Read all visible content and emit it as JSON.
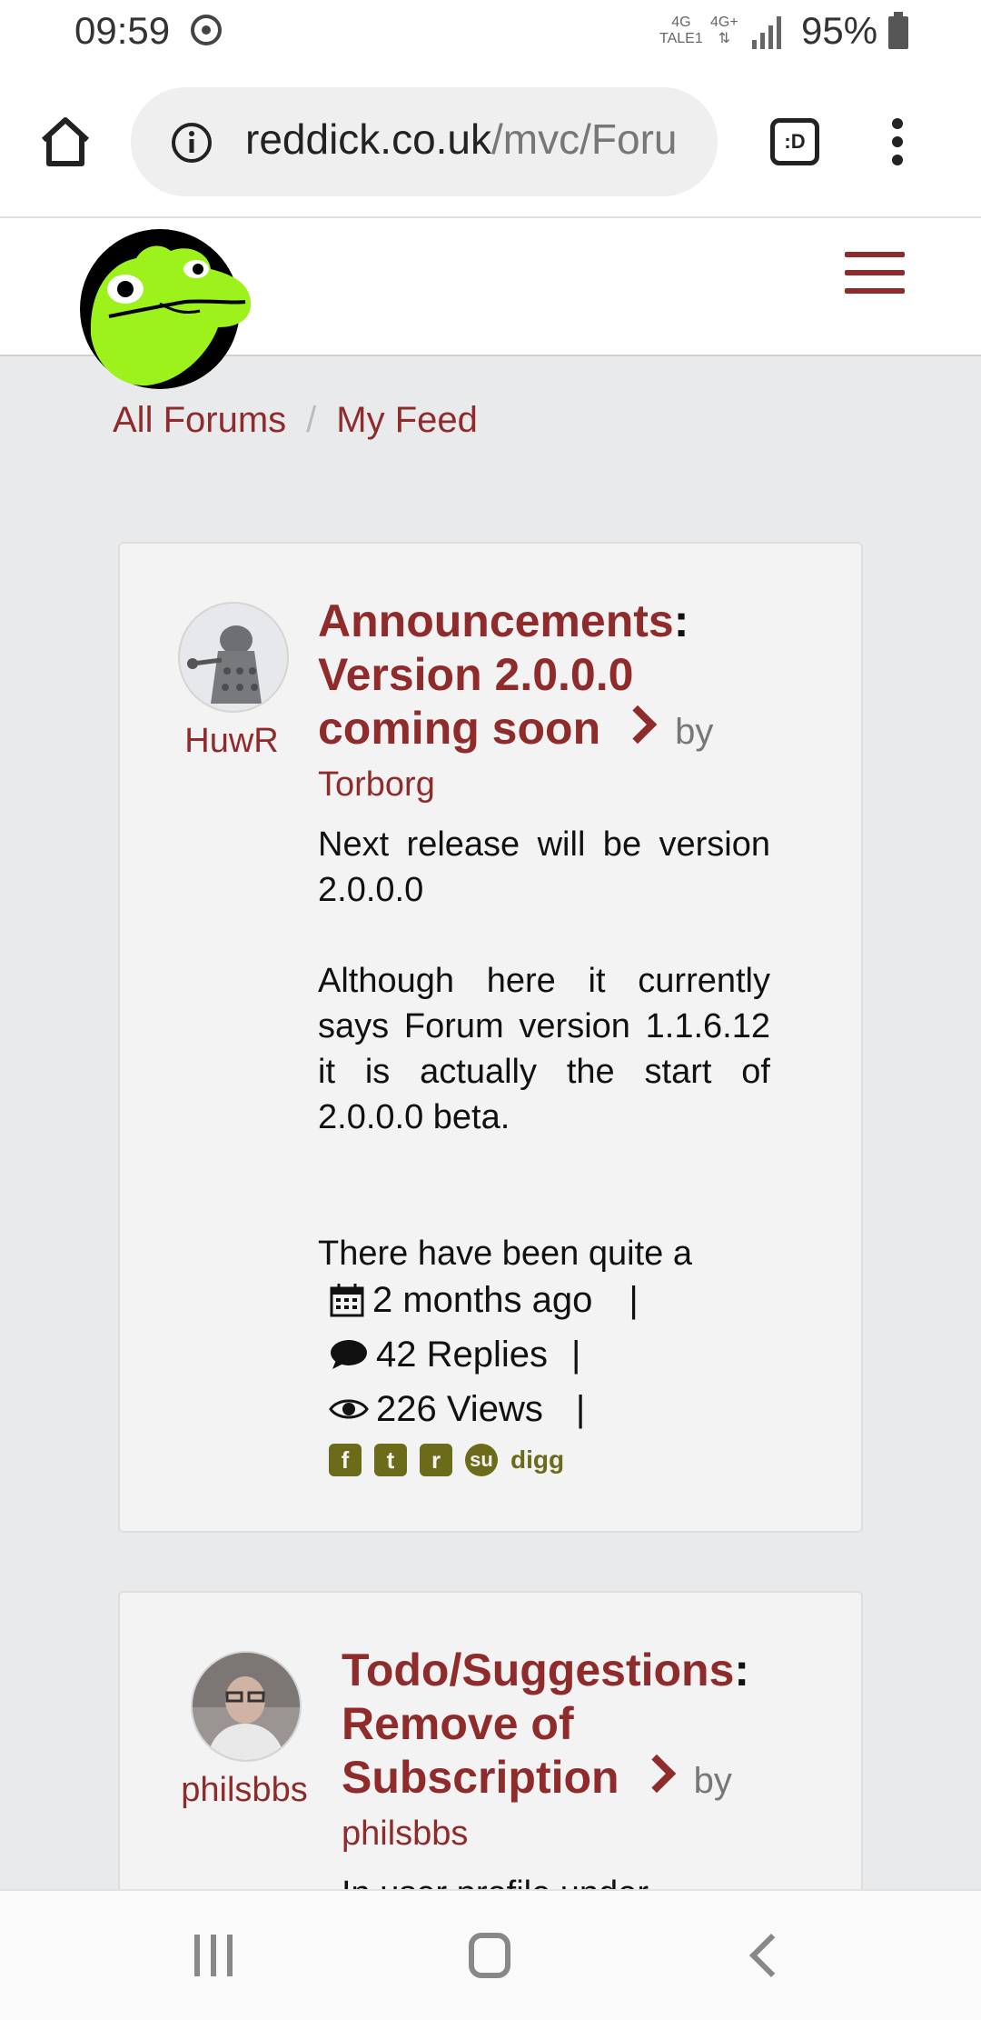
{
  "status_bar": {
    "time": "09:59",
    "net1_top": "4G",
    "net1_bottom": "TALE1",
    "net2_top": "4G+",
    "battery": "95%"
  },
  "browser": {
    "url_host": "reddick.co.uk",
    "url_path": "/mvc/Foru",
    "tab_label": ":D"
  },
  "breadcrumb": {
    "items": [
      "All Forums",
      "My Feed"
    ],
    "separator": "/"
  },
  "posts": [
    {
      "author": "HuwR",
      "forum": "Announcements",
      "colon": ":",
      "title_lines": [
        "Version 2.0.0.0",
        "coming soon"
      ],
      "by_label": "by",
      "byline_author": "Torborg",
      "body": [
        "Next release will be version 2.0.0.0",
        "Although here it currently says Forum version 1.1.6.12 it is actually the start of 2.0.0.0 beta.",
        "There have been quite a"
      ],
      "date": "2 months ago",
      "replies": "42 Replies",
      "views": "226 Views",
      "pipe": "|",
      "share": [
        "facebook-icon",
        "twitter-icon",
        "reddit-icon",
        "stumbleupon-icon",
        "digg"
      ],
      "share_digg_label": "digg"
    },
    {
      "author": "philsbbs",
      "forum": "Todo/Suggestions",
      "colon": ":",
      "title_lines": [
        "Remove of",
        "Subscription"
      ],
      "by_label": "by",
      "byline_author": "philsbbs",
      "body": [
        "In user profile under"
      ]
    }
  ],
  "colors": {
    "accent": "#8f2b2b",
    "share_icon": "#6b6b1a",
    "page_bg": "#e9eaec",
    "card_bg": "#f3f3f3"
  }
}
